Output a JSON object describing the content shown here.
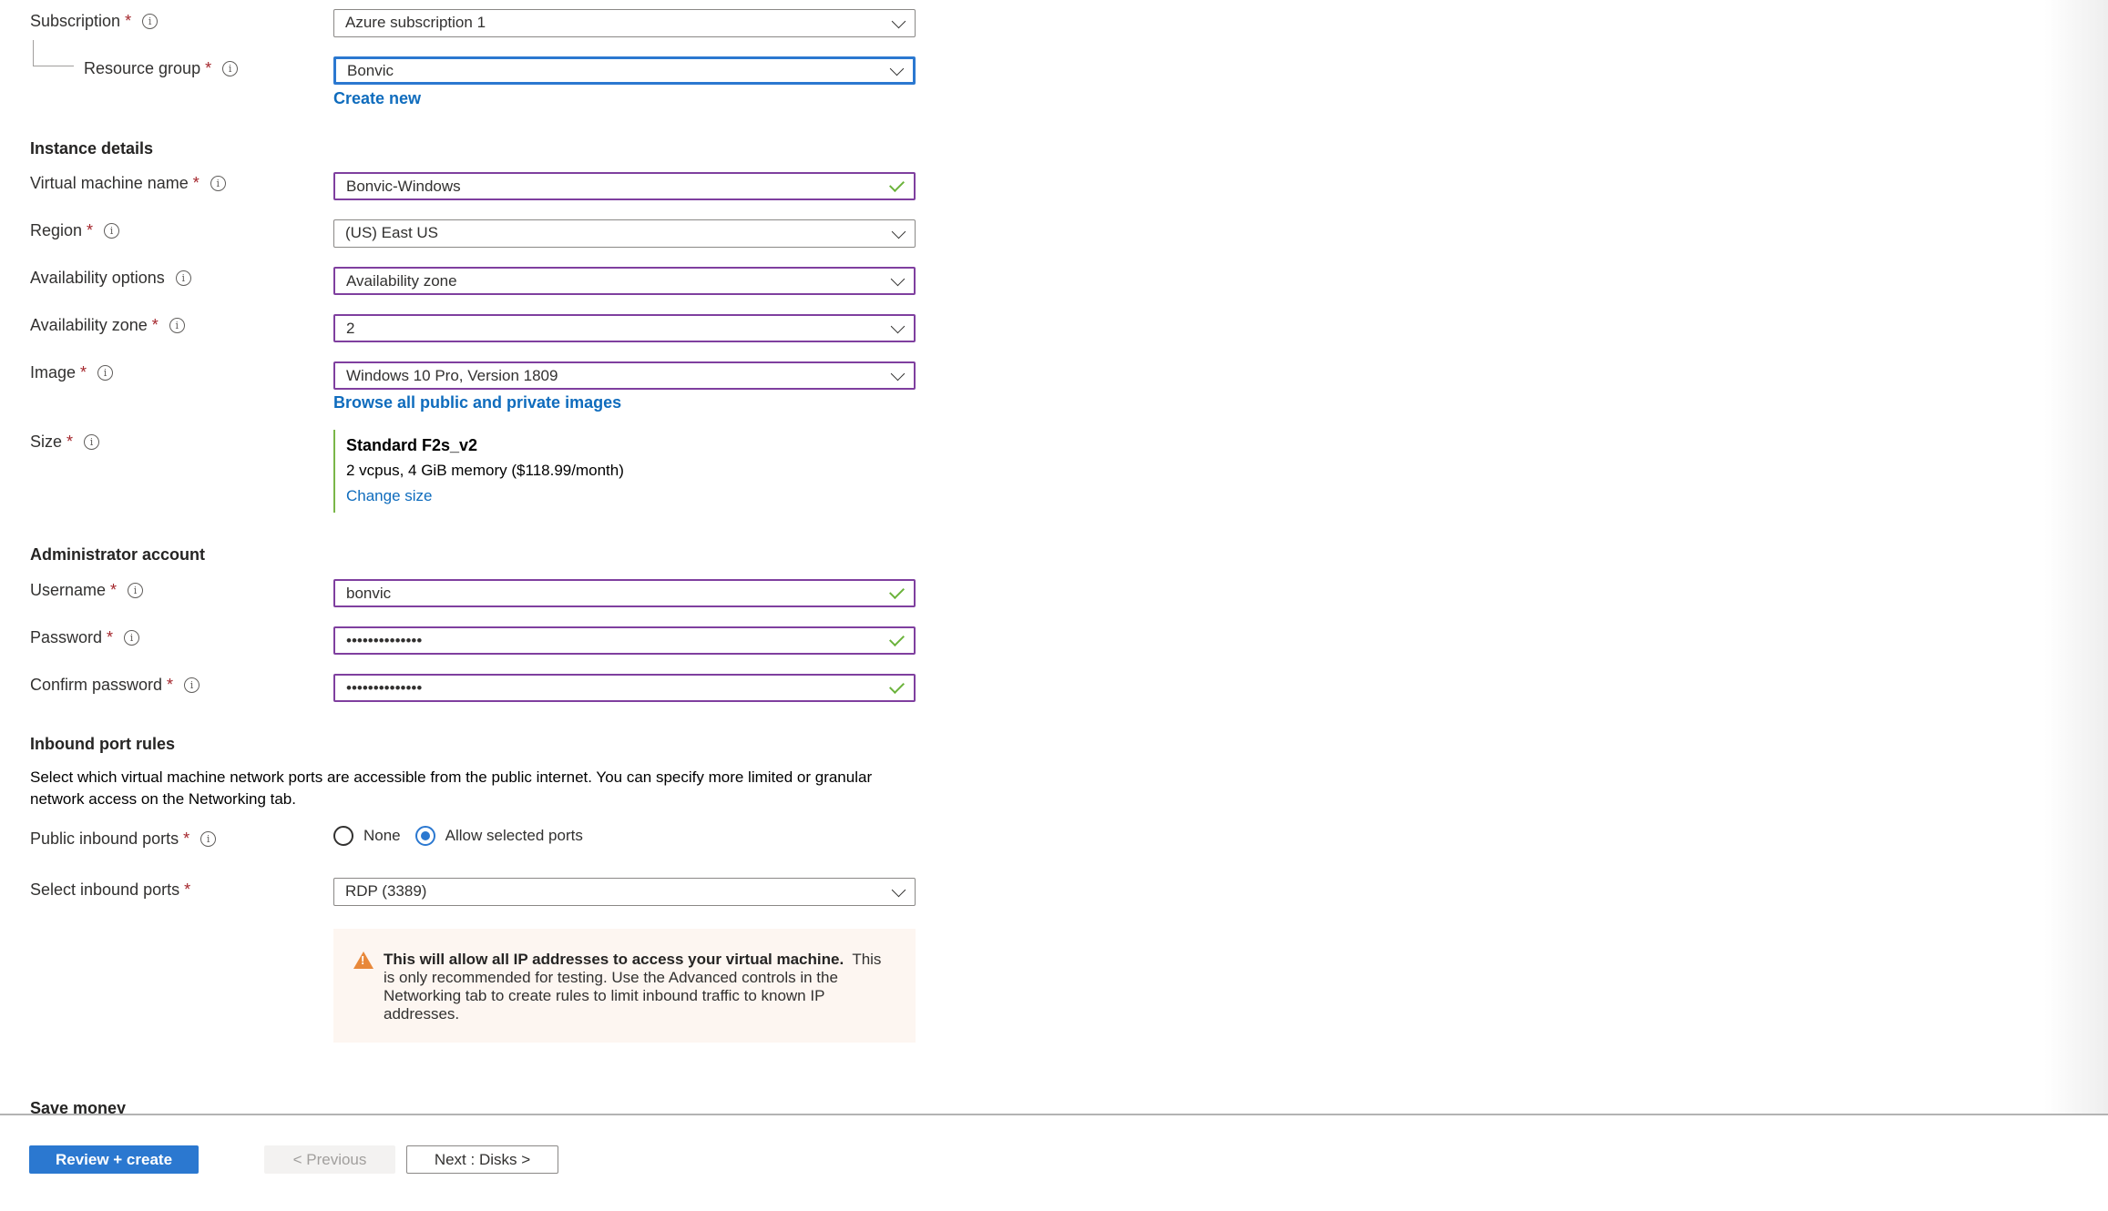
{
  "project_details": {
    "subscription": {
      "label": "Subscription",
      "value": "Azure subscription 1"
    },
    "resource_group": {
      "label": "Resource group",
      "value": "Bonvic",
      "create_new": "Create new"
    }
  },
  "instance_details": {
    "heading": "Instance details",
    "vm_name": {
      "label": "Virtual machine name",
      "value": "Bonvic-Windows"
    },
    "region": {
      "label": "Region",
      "value": "(US) East US"
    },
    "availability_options": {
      "label": "Availability options",
      "value": "Availability zone"
    },
    "availability_zone": {
      "label": "Availability zone",
      "value": "2"
    },
    "image": {
      "label": "Image",
      "value": "Windows 10 Pro, Version 1809",
      "browse_link": "Browse all public and private images"
    },
    "size": {
      "label": "Size",
      "name": "Standard F2s_v2",
      "description": "2 vcpus, 4 GiB memory ($118.99/month)",
      "change_link": "Change size"
    }
  },
  "admin_account": {
    "heading": "Administrator account",
    "username": {
      "label": "Username",
      "value": "bonvic"
    },
    "password": {
      "label": "Password",
      "value": "••••••••••••••"
    },
    "confirm_password": {
      "label": "Confirm password",
      "value": "••••••••••••••"
    }
  },
  "inbound_rules": {
    "heading": "Inbound port rules",
    "description": "Select which virtual machine network ports are accessible from the public internet. You can specify more limited or granular network access on the Networking tab.",
    "public_inbound_ports": {
      "label": "Public inbound ports",
      "options": [
        "None",
        "Allow selected ports"
      ],
      "selected": "Allow selected ports"
    },
    "select_inbound_ports": {
      "label": "Select inbound ports",
      "value": "RDP (3389)"
    },
    "warning": {
      "bold": "This will allow all IP addresses to access your virtual machine.",
      "text": "This is only recommended for testing.  Use the Advanced controls in the Networking tab to create rules to limit inbound traffic to known IP addresses."
    }
  },
  "save_money": {
    "heading": "Save money"
  },
  "footer": {
    "review_create": "Review + create",
    "previous": "< Previous",
    "next": "Next : Disks >"
  },
  "common": {
    "required_mark": "*",
    "info_glyph": "i"
  },
  "colors": {
    "accent": "#2b78d0",
    "valid_border": "#7f3f9f",
    "valid_check": "#6bb33b",
    "required": "#a4262c",
    "warning_bg": "#fdf6f1",
    "warning_icon": "#e8883a"
  }
}
